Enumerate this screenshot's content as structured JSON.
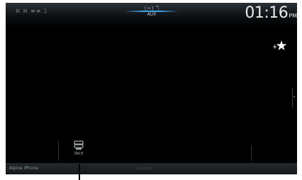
{
  "status": {
    "icons_text": "ℵ ℵ ≡≡ ℷ"
  },
  "header": {
    "mode_icon": "(=) ℸ",
    "source_label": "AUX"
  },
  "clock": {
    "time": "01:16",
    "ampm": "PM"
  },
  "favorite": {
    "icon": "add-favorite-star-icon"
  },
  "aux_button": {
    "label": "SRCE",
    "icon": "source-select-icon"
  },
  "bottom_bar": {
    "device_name": "Alpine iPhone",
    "center_label": "GOLDEN"
  },
  "colors": {
    "background": "#000000",
    "accent": "#3fa4e8",
    "clock_text": "#e7e9ea"
  }
}
